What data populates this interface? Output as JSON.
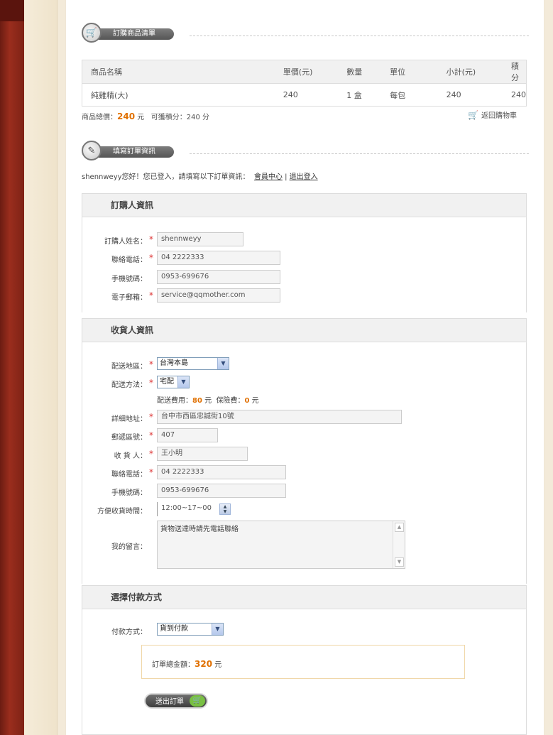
{
  "sections": {
    "cart_title": "訂購商品清單",
    "order_info_title": "填寫訂單資訊"
  },
  "items_table": {
    "headers": [
      "商品名稱",
      "單價(元)",
      "數量",
      "單位",
      "小計(元)",
      "積分"
    ],
    "rows": [
      [
        "純雞精(大)",
        "240",
        "1 盒",
        "每包",
        "240",
        "240"
      ]
    ]
  },
  "summary": {
    "total_label": "商品總價：",
    "total_value": "240",
    "total_unit": "元",
    "points_text": "可獲積分：240 分",
    "back_to_cart": "返回購物車"
  },
  "welcome": {
    "text": "shennweyy您好！您已登入，請填寫以下訂單資訊：",
    "member_link": "會員中心",
    "separator": "|",
    "logout_link": "退出登入"
  },
  "buyer": {
    "title": "訂購人資訊",
    "name_label": "訂購人姓名：",
    "name_value": "shennweyy",
    "phone_label": "聯絡電話：",
    "phone_value": "04 2222333",
    "mobile_label": "手機號碼：",
    "mobile_value": "0953-699676",
    "email_label": "電子郵箱：",
    "email_value": "service@qqmother.com"
  },
  "receiver": {
    "title": "收貨人資訊",
    "region_label": "配送地區：",
    "region_value": "台灣本島",
    "method_label": "配送方法：",
    "method_value": "宅配",
    "fee_label": "配送費用：",
    "fee_value": "80",
    "fee_unit": "元",
    "insurance_label": "保險費：",
    "insurance_value": "0",
    "insurance_unit": "元",
    "address_label": "詳細地址：",
    "address_value": "台中市西區忠誠街10號",
    "zip_label": "郵遞區號：",
    "zip_value": "407",
    "receiver_label": "收 貨 人：",
    "receiver_value": "王小明",
    "phone_label": "聯絡電話：",
    "phone_value": "04 2222333",
    "mobile_label": "手機號碼：",
    "mobile_value": "0953-699676",
    "time_label": "方便收貨時間：",
    "time_value": "12:00~17~00",
    "message_label": "我的留言：",
    "message_value": "貨物送達時請先電話聯絡"
  },
  "payment": {
    "title": "選擇付款方式",
    "method_label": "付款方式：",
    "method_value": "貨到付款",
    "total_label": "訂單總金額：",
    "total_value": "320",
    "total_unit": "元",
    "submit_label": "送出訂單"
  },
  "icons": {
    "cart_section": "shopping-cart-icon",
    "order_section": "pencil-icon",
    "back_cart": "cart-icon",
    "submit_cart": "cart-icon"
  },
  "colors": {
    "accent": "#e07000",
    "required": "#dd3333"
  }
}
